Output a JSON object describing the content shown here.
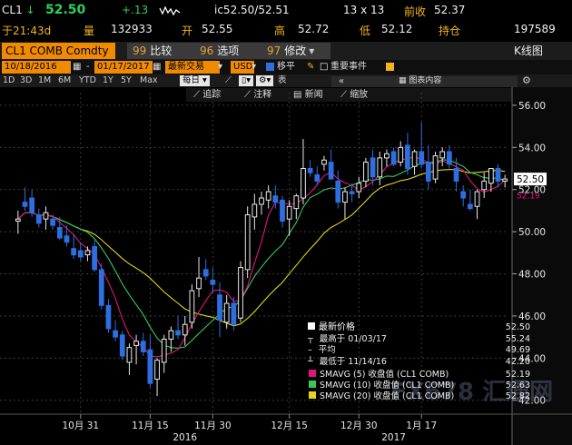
{
  "quote": {
    "ticker": "CL1",
    "arrow": "↓",
    "last": "52.50",
    "change": "+.13",
    "bid_ask": "ic52.50/52.51",
    "size": "13 x 13",
    "prev_close_label": "前收",
    "prev_close": "52.37",
    "time": "于21:43d",
    "volume_label": "量",
    "volume": "132933",
    "open_label": "开",
    "open": "52.55",
    "high_label": "高",
    "high": "52.72",
    "low_label": "低",
    "low": "52.12",
    "oi_label": "持仓",
    "oi": "197589"
  },
  "command": {
    "security": "CL1 COMB Comdty",
    "b1_num": "99",
    "b1_label": "比较",
    "b2_num": "96",
    "b2_label": "选项",
    "b3_num": "97",
    "b3_label": "修改",
    "title": "K线图"
  },
  "settings": {
    "start_date": "10/18/2016",
    "end_date": "01/17/2017",
    "mode": "最新交易",
    "currency": "USD",
    "move_label": "移平",
    "events_label": "重要事件"
  },
  "ranges": {
    "items": [
      "1D",
      "3D",
      "1M",
      "6M",
      "YTD",
      "1Y",
      "5Y",
      "Max"
    ],
    "period": "每日",
    "table_label": "表"
  },
  "tools": {
    "nav": "«",
    "legend_label": "图表内容",
    "trend_label": "追踪",
    "note_label": "注释",
    "news_label": "新闻",
    "zoom_label": "缩放"
  },
  "legend": {
    "rows": [
      {
        "label": "最新价格",
        "value": "52.50"
      },
      {
        "label": "最高于 01/03/17",
        "value": "55.24"
      },
      {
        "label": "平均",
        "value": "49.69"
      },
      {
        "label": "最低于 11/14/16",
        "value": "42.20"
      },
      {
        "label": "SMAVG (5) 收盘值 (CL1 COMB)",
        "value": "52.19"
      },
      {
        "label": "SMAVG (10) 收盘值 (CL1 COMB)",
        "value": "52.63"
      },
      {
        "label": "SMAVG (20) 收盘值 (CL1 COMB)",
        "value": "52.82"
      }
    ]
  },
  "watermark": "FX678 汇通网",
  "colors": {
    "up": "#e8e8e8",
    "down": "#2d6fe0",
    "sma5": "#e0157d",
    "sma10": "#36c957",
    "sma20": "#e3d41c",
    "accent": "#f08a00"
  },
  "chart_data": {
    "type": "candlestick",
    "y_axis": {
      "min": 41.6,
      "max": 56.6,
      "ticks": [
        "56.00",
        "54.00",
        "52.00",
        "50.00",
        "48.00",
        "46.00",
        "44.00",
        "42.00"
      ],
      "tick_values": [
        56,
        54,
        52,
        50,
        48,
        46,
        44,
        42
      ],
      "side": "right"
    },
    "x_ticks": [
      "10月 31",
      "11月 15",
      "11月 30",
      "12月 15",
      "12月 30",
      "1月 17"
    ],
    "x_tick_index": [
      9,
      19,
      28,
      39,
      49,
      58
    ],
    "year_labels": [
      "2016",
      "2017"
    ],
    "year_label_index": [
      24,
      54
    ],
    "last_price_label": "52.50",
    "sma_price_label": "52.19",
    "ohlc": [
      [
        50.5,
        51.0,
        49.9,
        50.6
      ],
      [
        51.4,
        52.1,
        51.0,
        51.2
      ],
      [
        51.6,
        52.0,
        50.7,
        50.9
      ],
      [
        50.8,
        51.1,
        50.2,
        50.4
      ],
      [
        50.6,
        51.2,
        50.1,
        50.9
      ],
      [
        50.6,
        50.8,
        50.1,
        50.3
      ],
      [
        50.2,
        50.7,
        49.6,
        49.7
      ],
      [
        49.8,
        50.3,
        49.3,
        49.5
      ],
      [
        49.2,
        49.9,
        48.7,
        48.9
      ],
      [
        49.1,
        49.5,
        48.6,
        48.8
      ],
      [
        48.9,
        49.3,
        48.6,
        49.1
      ],
      [
        49.3,
        49.6,
        48.1,
        48.2
      ],
      [
        48.2,
        48.5,
        46.3,
        46.5
      ],
      [
        46.5,
        46.8,
        45.2,
        45.4
      ],
      [
        45.3,
        45.8,
        44.8,
        45.0
      ],
      [
        45.1,
        45.3,
        43.9,
        44.1
      ],
      [
        43.8,
        44.7,
        43.2,
        44.5
      ],
      [
        44.6,
        45.1,
        43.7,
        44.8
      ],
      [
        44.8,
        45.2,
        44.1,
        44.3
      ],
      [
        44.4,
        45.1,
        42.6,
        42.8
      ],
      [
        43.0,
        44.0,
        42.2,
        43.9
      ],
      [
        43.8,
        45.1,
        43.3,
        44.9
      ],
      [
        44.9,
        45.5,
        44.3,
        45.3
      ],
      [
        45.3,
        46.0,
        44.9,
        45.1
      ],
      [
        45.1,
        46.0,
        44.6,
        45.6
      ],
      [
        45.7,
        47.5,
        45.4,
        47.2
      ],
      [
        47.3,
        48.8,
        46.9,
        47.8
      ],
      [
        48.2,
        48.7,
        47.7,
        47.9
      ],
      [
        47.7,
        48.3,
        47.1,
        47.5
      ],
      [
        47.0,
        47.6,
        45.0,
        45.8
      ],
      [
        45.7,
        47.0,
        45.4,
        46.6
      ],
      [
        46.6,
        46.9,
        45.3,
        45.6
      ],
      [
        45.9,
        48.6,
        45.7,
        48.3
      ],
      [
        48.2,
        51.2,
        47.8,
        50.8
      ],
      [
        50.7,
        51.8,
        50.1,
        51.3
      ],
      [
        51.3,
        51.9,
        50.8,
        51.6
      ],
      [
        51.5,
        52.2,
        51.1,
        51.9
      ],
      [
        51.7,
        52.2,
        51.1,
        51.4
      ],
      [
        51.5,
        51.7,
        50.2,
        50.5
      ],
      [
        50.6,
        51.5,
        49.8,
        51.2
      ],
      [
        51.1,
        51.8,
        50.6,
        51.7
      ],
      [
        51.6,
        54.4,
        51.3,
        53.0
      ],
      [
        53.0,
        53.4,
        52.6,
        52.8
      ],
      [
        52.7,
        53.1,
        52.2,
        52.4
      ],
      [
        53.2,
        53.6,
        52.9,
        53.4
      ],
      [
        53.3,
        53.9,
        52.8,
        52.5
      ],
      [
        52.4,
        52.9,
        51.1,
        51.4
      ],
      [
        51.4,
        52.1,
        50.6,
        51.9
      ],
      [
        51.9,
        52.3,
        51.4,
        51.8
      ],
      [
        51.9,
        52.6,
        51.6,
        52.3
      ],
      [
        52.4,
        53.5,
        52.1,
        53.3
      ],
      [
        53.5,
        53.9,
        52.2,
        52.6
      ],
      [
        52.6,
        53.8,
        52.2,
        53.5
      ],
      [
        53.5,
        53.9,
        53.1,
        53.7
      ],
      [
        53.8,
        54.0,
        53.1,
        53.2
      ],
      [
        53.3,
        54.3,
        53.1,
        54.0
      ],
      [
        54.1,
        54.7,
        52.7,
        53.0
      ],
      [
        53.1,
        53.9,
        52.7,
        53.8
      ],
      [
        53.8,
        55.2,
        53.0,
        53.2
      ],
      [
        53.3,
        54.1,
        52.0,
        52.4
      ],
      [
        52.5,
        53.8,
        52.3,
        53.6
      ],
      [
        53.5,
        54.0,
        53.1,
        53.8
      ],
      [
        53.8,
        54.1,
        53.0,
        53.2
      ],
      [
        53.0,
        53.5,
        51.9,
        52.4
      ],
      [
        51.9,
        52.2,
        51.2,
        51.6
      ],
      [
        51.3,
        52.0,
        51.0,
        51.1
      ],
      [
        51.2,
        52.0,
        50.6,
        51.9
      ],
      [
        52.0,
        52.8,
        51.6,
        52.4
      ],
      [
        52.3,
        53.0,
        51.9,
        53.0
      ],
      [
        53.0,
        53.2,
        52.1,
        52.4
      ],
      [
        52.4,
        52.7,
        52.1,
        52.5
      ]
    ]
  }
}
